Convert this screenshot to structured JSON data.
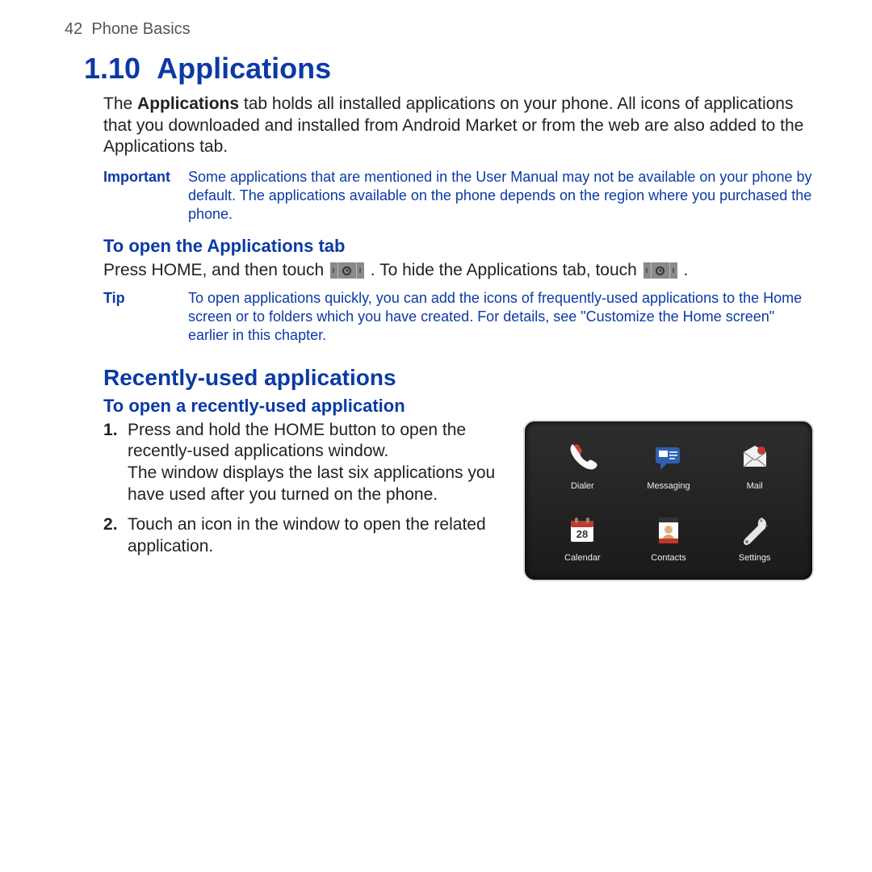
{
  "page": {
    "number": "42",
    "chapter": "Phone Basics"
  },
  "section": {
    "number": "1.10",
    "title": "Applications"
  },
  "intro": {
    "bold_word": "Applications",
    "before": "The ",
    "after": " tab holds all installed applications on your phone. All icons of applications that you downloaded and installed from Android Market or from the web are also added to the Applications tab."
  },
  "important": {
    "label": "Important",
    "text": "Some applications that are mentioned in the User Manual may not be available on your phone by default. The applications available on the phone depends on the region where you purchased the phone."
  },
  "open_tab": {
    "heading": "To open the Applications tab",
    "text_before_icon": "Press HOME, and then touch ",
    "text_middle": " . To hide the Applications tab, touch ",
    "text_after": " ."
  },
  "tip": {
    "label": "Tip",
    "text": "To open applications quickly, you can add the icons of frequently-used applications to the Home screen or to folders which you have created. For details, see \"Customize the Home screen\" earlier in this chapter."
  },
  "recent": {
    "heading": "Recently-used applications",
    "sub": "To open a recently-used application",
    "step1": "Press and hold the HOME button to open the recently-used applications window.\nThe window displays the last six applications you have used after you turned on the phone.",
    "step2": "Touch an icon in the window to open the related application.",
    "apps": {
      "dialer": "Dialer",
      "messaging": "Messaging",
      "mail": "Mail",
      "calendar": "Calendar",
      "calendar_day": "28",
      "contacts": "Contacts",
      "settings": "Settings"
    }
  }
}
